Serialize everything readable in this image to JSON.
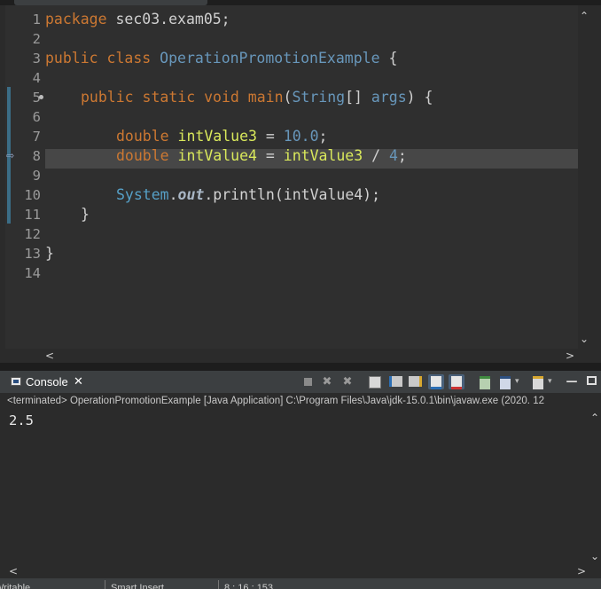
{
  "editor": {
    "lines": [
      {
        "n": "1",
        "y": 0
      },
      {
        "n": "2",
        "y": 0
      },
      {
        "n": "3",
        "y": 0
      },
      {
        "n": "4",
        "y": 0
      },
      {
        "n": "5",
        "y": 0
      },
      {
        "n": "6",
        "y": 0
      },
      {
        "n": "7",
        "y": 0
      },
      {
        "n": "8",
        "y": 0
      },
      {
        "n": "9",
        "y": 0
      },
      {
        "n": "10",
        "y": 0
      },
      {
        "n": "11",
        "y": 0
      },
      {
        "n": "12",
        "y": 0
      },
      {
        "n": "13",
        "y": 0
      },
      {
        "n": "14",
        "y": 0
      }
    ],
    "code": {
      "l1_kw": "package",
      "l1_rest": " sec03.exam05;",
      "l3_kw1": "public",
      "l3_kw2": "class",
      "l3_cls": "OperationPromotionExample",
      "l3_rest": " {",
      "l5_kw1": "public",
      "l5_kw2": "static",
      "l5_kw3": "void",
      "l5_meth": "main",
      "l5_open": "(",
      "l5_type": "String",
      "l5_arr": "[] ",
      "l5_arg": "args",
      "l5_close": ") {",
      "l7_kw": "double",
      "l7_var": "intValue3",
      "l7_eq": " = ",
      "l7_num": "10.0",
      "l7_end": ";",
      "l8_kw": "double",
      "l8_var": "intValue4",
      "l8_eq": " = ",
      "l8_var2": "intValue3",
      "l8_op": " / ",
      "l8_num": "4",
      "l8_end": ";",
      "l10_sys": "System",
      "l10_dot1": ".",
      "l10_fld": "out",
      "l10_dot2": ".",
      "l10_meth": "println",
      "l10_rest": "(intValue4);",
      "l11": "}",
      "l13": "}"
    }
  },
  "console": {
    "tab_label": "Console",
    "status": "<terminated> OperationPromotionExample [Java Application] C:\\Program Files\\Java\\jdk-15.0.1\\bin\\javaw.exe  (2020. 12",
    "output": "2.5"
  },
  "statusbar": {
    "writable": "Writable",
    "insert_mode": "Smart Insert",
    "position": "8 : 16 : 153"
  },
  "icons": {
    "console": "console-icon",
    "close": "close-icon",
    "terminate": "terminate-icon",
    "remove": "remove-launch-icon",
    "remove_all": "remove-all-terminated-icon",
    "clear": "clear-console-icon",
    "scroll_lock": "scroll-lock-icon",
    "word_wrap": "word-wrap-icon",
    "pin": "pin-console-icon",
    "open_console": "open-console-icon",
    "new_console": "new-console-icon",
    "minimize": "minimize-icon",
    "maximize": "maximize-icon"
  }
}
